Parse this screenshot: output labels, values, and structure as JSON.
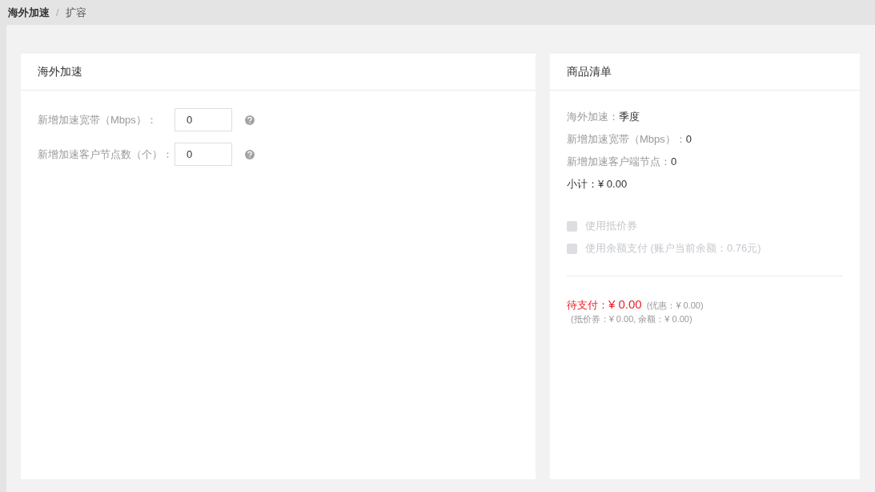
{
  "breadcrumb": [
    "海外加速",
    "扩容"
  ],
  "breadcrumb_separator": "/",
  "form_card": {
    "title": "海外加速",
    "fields": [
      {
        "label": "新增加速宽带（Mbps）：",
        "value": "0"
      },
      {
        "label": "新增加速客户节点数（个）：",
        "value": "0"
      }
    ]
  },
  "summary_card": {
    "title": "商品清单",
    "items": [
      {
        "label": "海外加速：",
        "value": "季度"
      },
      {
        "label": "新增加速宽带（Mbps）：",
        "value": "0"
      },
      {
        "label": "新增加速客户端节点：",
        "value": "0"
      }
    ],
    "subtotal": "小计：¥ 0.00",
    "options": [
      {
        "label": "使用抵价券",
        "checked": false,
        "disabled": true
      },
      {
        "label": "使用余额支付",
        "note": "(账户当前余额：0.76元)",
        "checked": false,
        "disabled": true
      }
    ],
    "pay_label": "待支付：",
    "pay_amount": "¥ 0.00",
    "discount": "(优惠：¥ 0.00)",
    "breakdown": "(抵价券：¥ 0.00, 余额：¥ 0.00)"
  }
}
